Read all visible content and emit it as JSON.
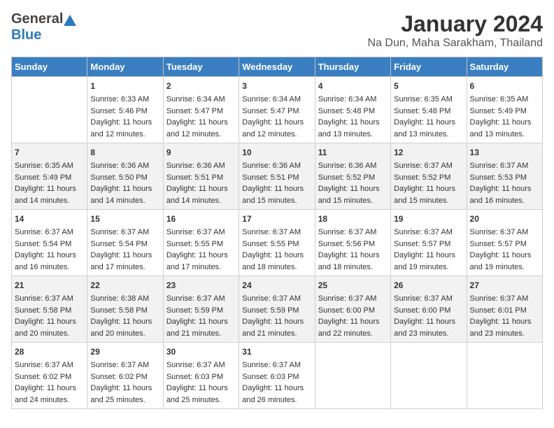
{
  "header": {
    "logo_general": "General",
    "logo_blue": "Blue",
    "month": "January 2024",
    "location": "Na Dun, Maha Sarakham, Thailand"
  },
  "weekdays": [
    "Sunday",
    "Monday",
    "Tuesday",
    "Wednesday",
    "Thursday",
    "Friday",
    "Saturday"
  ],
  "weeks": [
    [
      {
        "day": "",
        "sunrise": "",
        "sunset": "",
        "daylight": ""
      },
      {
        "day": "1",
        "sunrise": "Sunrise: 6:33 AM",
        "sunset": "Sunset: 5:46 PM",
        "daylight": "Daylight: 11 hours and 12 minutes."
      },
      {
        "day": "2",
        "sunrise": "Sunrise: 6:34 AM",
        "sunset": "Sunset: 5:47 PM",
        "daylight": "Daylight: 11 hours and 12 minutes."
      },
      {
        "day": "3",
        "sunrise": "Sunrise: 6:34 AM",
        "sunset": "Sunset: 5:47 PM",
        "daylight": "Daylight: 11 hours and 12 minutes."
      },
      {
        "day": "4",
        "sunrise": "Sunrise: 6:34 AM",
        "sunset": "Sunset: 5:48 PM",
        "daylight": "Daylight: 11 hours and 13 minutes."
      },
      {
        "day": "5",
        "sunrise": "Sunrise: 6:35 AM",
        "sunset": "Sunset: 5:48 PM",
        "daylight": "Daylight: 11 hours and 13 minutes."
      },
      {
        "day": "6",
        "sunrise": "Sunrise: 6:35 AM",
        "sunset": "Sunset: 5:49 PM",
        "daylight": "Daylight: 11 hours and 13 minutes."
      }
    ],
    [
      {
        "day": "7",
        "sunrise": "Sunrise: 6:35 AM",
        "sunset": "Sunset: 5:49 PM",
        "daylight": "Daylight: 11 hours and 14 minutes."
      },
      {
        "day": "8",
        "sunrise": "Sunrise: 6:36 AM",
        "sunset": "Sunset: 5:50 PM",
        "daylight": "Daylight: 11 hours and 14 minutes."
      },
      {
        "day": "9",
        "sunrise": "Sunrise: 6:36 AM",
        "sunset": "Sunset: 5:51 PM",
        "daylight": "Daylight: 11 hours and 14 minutes."
      },
      {
        "day": "10",
        "sunrise": "Sunrise: 6:36 AM",
        "sunset": "Sunset: 5:51 PM",
        "daylight": "Daylight: 11 hours and 15 minutes."
      },
      {
        "day": "11",
        "sunrise": "Sunrise: 6:36 AM",
        "sunset": "Sunset: 5:52 PM",
        "daylight": "Daylight: 11 hours and 15 minutes."
      },
      {
        "day": "12",
        "sunrise": "Sunrise: 6:37 AM",
        "sunset": "Sunset: 5:52 PM",
        "daylight": "Daylight: 11 hours and 15 minutes."
      },
      {
        "day": "13",
        "sunrise": "Sunrise: 6:37 AM",
        "sunset": "Sunset: 5:53 PM",
        "daylight": "Daylight: 11 hours and 16 minutes."
      }
    ],
    [
      {
        "day": "14",
        "sunrise": "Sunrise: 6:37 AM",
        "sunset": "Sunset: 5:54 PM",
        "daylight": "Daylight: 11 hours and 16 minutes."
      },
      {
        "day": "15",
        "sunrise": "Sunrise: 6:37 AM",
        "sunset": "Sunset: 5:54 PM",
        "daylight": "Daylight: 11 hours and 17 minutes."
      },
      {
        "day": "16",
        "sunrise": "Sunrise: 6:37 AM",
        "sunset": "Sunset: 5:55 PM",
        "daylight": "Daylight: 11 hours and 17 minutes."
      },
      {
        "day": "17",
        "sunrise": "Sunrise: 6:37 AM",
        "sunset": "Sunset: 5:55 PM",
        "daylight": "Daylight: 11 hours and 18 minutes."
      },
      {
        "day": "18",
        "sunrise": "Sunrise: 6:37 AM",
        "sunset": "Sunset: 5:56 PM",
        "daylight": "Daylight: 11 hours and 18 minutes."
      },
      {
        "day": "19",
        "sunrise": "Sunrise: 6:37 AM",
        "sunset": "Sunset: 5:57 PM",
        "daylight": "Daylight: 11 hours and 19 minutes."
      },
      {
        "day": "20",
        "sunrise": "Sunrise: 6:37 AM",
        "sunset": "Sunset: 5:57 PM",
        "daylight": "Daylight: 11 hours and 19 minutes."
      }
    ],
    [
      {
        "day": "21",
        "sunrise": "Sunrise: 6:37 AM",
        "sunset": "Sunset: 5:58 PM",
        "daylight": "Daylight: 11 hours and 20 minutes."
      },
      {
        "day": "22",
        "sunrise": "Sunrise: 6:38 AM",
        "sunset": "Sunset: 5:58 PM",
        "daylight": "Daylight: 11 hours and 20 minutes."
      },
      {
        "day": "23",
        "sunrise": "Sunrise: 6:37 AM",
        "sunset": "Sunset: 5:59 PM",
        "daylight": "Daylight: 11 hours and 21 minutes."
      },
      {
        "day": "24",
        "sunrise": "Sunrise: 6:37 AM",
        "sunset": "Sunset: 5:59 PM",
        "daylight": "Daylight: 11 hours and 21 minutes."
      },
      {
        "day": "25",
        "sunrise": "Sunrise: 6:37 AM",
        "sunset": "Sunset: 6:00 PM",
        "daylight": "Daylight: 11 hours and 22 minutes."
      },
      {
        "day": "26",
        "sunrise": "Sunrise: 6:37 AM",
        "sunset": "Sunset: 6:00 PM",
        "daylight": "Daylight: 11 hours and 23 minutes."
      },
      {
        "day": "27",
        "sunrise": "Sunrise: 6:37 AM",
        "sunset": "Sunset: 6:01 PM",
        "daylight": "Daylight: 11 hours and 23 minutes."
      }
    ],
    [
      {
        "day": "28",
        "sunrise": "Sunrise: 6:37 AM",
        "sunset": "Sunset: 6:02 PM",
        "daylight": "Daylight: 11 hours and 24 minutes."
      },
      {
        "day": "29",
        "sunrise": "Sunrise: 6:37 AM",
        "sunset": "Sunset: 6:02 PM",
        "daylight": "Daylight: 11 hours and 25 minutes."
      },
      {
        "day": "30",
        "sunrise": "Sunrise: 6:37 AM",
        "sunset": "Sunset: 6:03 PM",
        "daylight": "Daylight: 11 hours and 25 minutes."
      },
      {
        "day": "31",
        "sunrise": "Sunrise: 6:37 AM",
        "sunset": "Sunset: 6:03 PM",
        "daylight": "Daylight: 11 hours and 26 minutes."
      },
      {
        "day": "",
        "sunrise": "",
        "sunset": "",
        "daylight": ""
      },
      {
        "day": "",
        "sunrise": "",
        "sunset": "",
        "daylight": ""
      },
      {
        "day": "",
        "sunrise": "",
        "sunset": "",
        "daylight": ""
      }
    ]
  ]
}
